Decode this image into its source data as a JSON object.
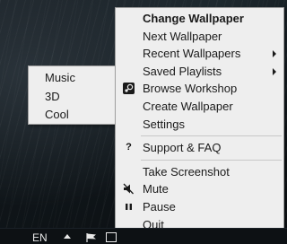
{
  "context_menu": {
    "items": [
      {
        "label": "Change Wallpaper",
        "bold": true
      },
      {
        "label": "Next Wallpaper"
      },
      {
        "label": "Recent Wallpapers",
        "has_submenu": true
      },
      {
        "label": "Saved Playlists",
        "has_submenu": true
      },
      {
        "label": "Browse Workshop",
        "icon": "steam-icon"
      },
      {
        "label": "Create Wallpaper"
      },
      {
        "label": "Settings"
      },
      {
        "label": "Support & FAQ",
        "icon": "question-mark-icon"
      },
      {
        "label": "Take Screenshot"
      },
      {
        "label": "Mute",
        "icon": "speaker-muted-icon"
      },
      {
        "label": "Pause",
        "icon": "pause-icon"
      },
      {
        "label": "Quit"
      }
    ]
  },
  "submenu": {
    "items": [
      {
        "label": "Music"
      },
      {
        "label": "3D"
      },
      {
        "label": "Cool"
      }
    ]
  },
  "taskbar": {
    "language": "EN"
  },
  "colors": {
    "menu_background": "#eeeeee",
    "menu_border": "#a0a0a0",
    "desktop": "#141b20"
  }
}
